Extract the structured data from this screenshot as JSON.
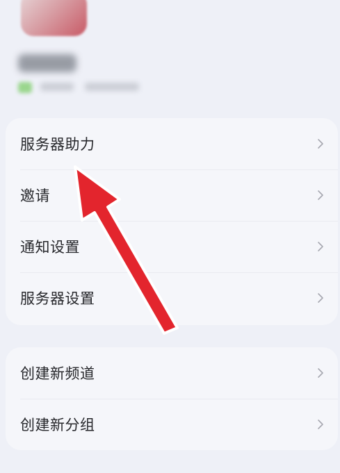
{
  "menu_group_1": [
    {
      "label": "服务器助力"
    },
    {
      "label": "邀请"
    },
    {
      "label": "通知设置"
    },
    {
      "label": "服务器设置"
    }
  ],
  "menu_group_2": [
    {
      "label": "创建新频道"
    },
    {
      "label": "创建新分组"
    }
  ],
  "icons": {
    "row_chevron": "chevron-right-icon",
    "annotation": "red-arrow-annotation"
  },
  "colors": {
    "background": "#eef0f7",
    "card": "#f5f6fa",
    "text": "#26272b",
    "chevron": "#a6a8b0",
    "annotation": "#e3252d"
  }
}
